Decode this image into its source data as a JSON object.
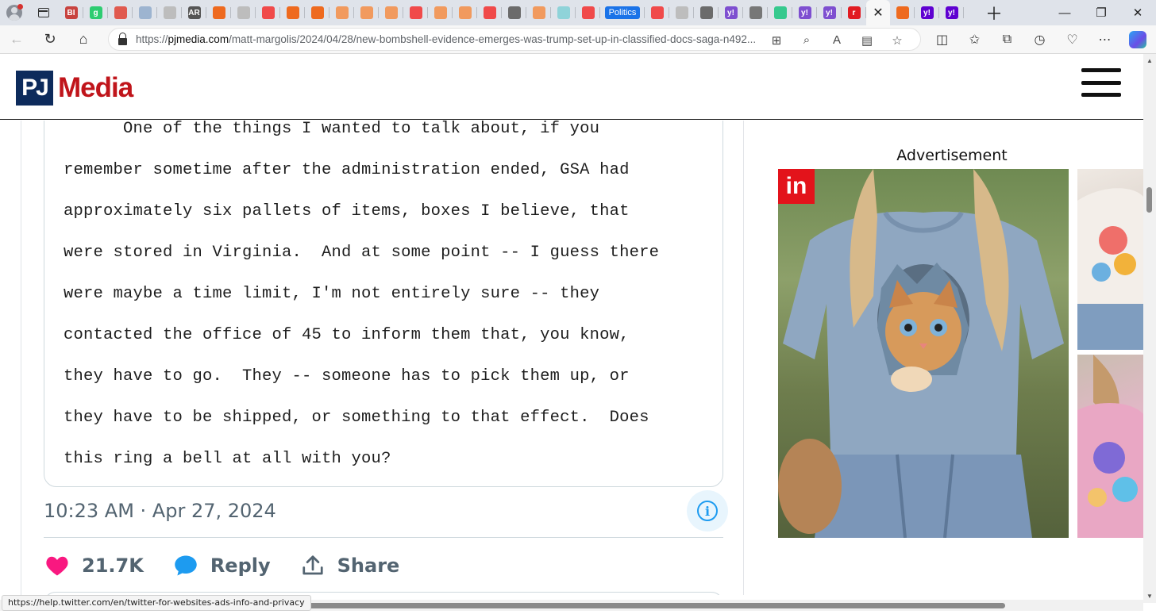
{
  "browser": {
    "tabs": [
      {
        "icon": "profile-avatar-icon"
      },
      {
        "icon": "bi-favicon",
        "color": "#c8433f",
        "text": "BI"
      },
      {
        "icon": "g-favicon",
        "color": "#2ecc71",
        "text": "g"
      },
      {
        "icon": "pocket-favicon",
        "color": "#e05a4f",
        "text": ""
      },
      {
        "icon": "search-favicon",
        "color": "#9db4d0",
        "text": ""
      },
      {
        "icon": "page-favicon",
        "color": "#bdbdbd",
        "text": ""
      },
      {
        "icon": "ar-favicon",
        "color": "#555555",
        "text": "AR"
      },
      {
        "icon": "bookmark-favicon",
        "color": "#ee6a1f",
        "text": ""
      },
      {
        "icon": "page-favicon",
        "color": "#bdbdbd",
        "text": ""
      },
      {
        "icon": "youtube-favicon",
        "color": "#f04a4a",
        "text": ""
      },
      {
        "icon": "bookmark-favicon",
        "color": "#ee6a1f",
        "text": ""
      },
      {
        "icon": "bookmark-favicon",
        "color": "#ee6a1f",
        "text": ""
      },
      {
        "icon": "bookmark-favicon",
        "color": "#f19a5e",
        "text": ""
      },
      {
        "icon": "bookmark-favicon",
        "color": "#f19a5e",
        "text": ""
      },
      {
        "icon": "bookmark-favicon",
        "color": "#f19a5e",
        "text": ""
      },
      {
        "icon": "youtube-favicon",
        "color": "#f04a4a",
        "text": ""
      },
      {
        "icon": "bookmark-favicon",
        "color": "#f19a5e",
        "text": ""
      },
      {
        "icon": "bookmark-favicon",
        "color": "#f19a5e",
        "text": ""
      },
      {
        "icon": "youtube-favicon",
        "color": "#f04a4a",
        "text": ""
      },
      {
        "icon": "gray-favicon",
        "color": "#6b6b6b",
        "text": ""
      },
      {
        "icon": "bookmark-favicon",
        "color": "#f19a5e",
        "text": ""
      },
      {
        "icon": "chat-favicon",
        "color": "#8fd3d9",
        "text": ""
      },
      {
        "icon": "youtube-favicon",
        "color": "#f04a4a",
        "text": ""
      }
    ],
    "labeled_tab": "Politics",
    "tabs_after": [
      {
        "icon": "youtube-favicon",
        "color": "#f04a4a",
        "text": ""
      },
      {
        "icon": "page-favicon",
        "color": "#bdbdbd",
        "text": ""
      },
      {
        "icon": "gray-favicon",
        "color": "#6b6b6b",
        "text": ""
      },
      {
        "icon": "yahoo-favicon",
        "color": "#7e4fd0",
        "text": "y!"
      },
      {
        "icon": "gray-circle-favicon",
        "color": "#777777",
        "text": ""
      },
      {
        "icon": "play-favicon",
        "color": "#36c98e",
        "text": ""
      },
      {
        "icon": "yahoo-favicon",
        "color": "#7e4fd0",
        "text": "y!"
      },
      {
        "icon": "yahoo-favicon",
        "color": "#7e4fd0",
        "text": "y!"
      },
      {
        "icon": "r-favicon",
        "color": "#e11b22",
        "text": "r"
      }
    ],
    "tabs_end": [
      {
        "icon": "bookmark-favicon",
        "color": "#ee6a1f",
        "text": ""
      },
      {
        "icon": "yahoo-favicon",
        "color": "#5f01d1",
        "text": "y!"
      },
      {
        "icon": "yahoo-favicon",
        "color": "#5f01d1",
        "text": "y!"
      }
    ],
    "url_prefix": "https://",
    "url_host": "pjmedia.com",
    "url_path": "/matt-margolis/2024/04/28/new-bombshell-evidence-emerges-was-trump-set-up-in-classified-docs-saga-n492..."
  },
  "site": {
    "logo_pj": "PJ",
    "logo_media": "Media"
  },
  "tweet": {
    "doc_lines": [
      "      One of the things I wanted to talk about, if you",
      "remember sometime after the administration ended, GSA had",
      "approximately six pallets of items, boxes I believe, that",
      "were stored in Virginia.  And at some point -- I guess there",
      "were maybe a time limit, I'm not entirely sure -- they",
      "contacted the office of 45 to inform them that, you know,",
      "they have to go.  They -- someone has to pick them up, or",
      "they have to be shipped, or something to that effect.  Does",
      "this ring a bell at all with you?"
    ],
    "timestamp": "10:23 AM · Apr 27, 2024",
    "likes": "21.7K",
    "reply_label": "Reply",
    "share_label": "Share",
    "like_color": "#f91880",
    "reply_color": "#1d9bf0"
  },
  "ad": {
    "label": "Advertisement",
    "badge": "in"
  },
  "status_url": "https://help.twitter.com/en/twitter-for-websites-ads-info-and-privacy"
}
